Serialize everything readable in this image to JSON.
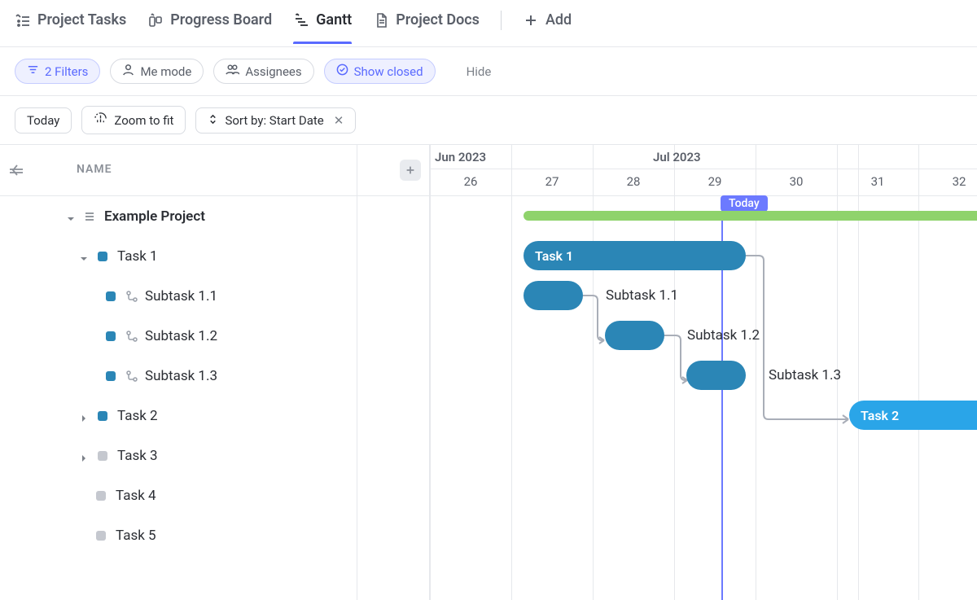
{
  "tabs": {
    "items": [
      {
        "label": "Project Tasks"
      },
      {
        "label": "Progress Board"
      },
      {
        "label": "Gantt"
      },
      {
        "label": "Project Docs"
      }
    ],
    "add": "Add"
  },
  "pills": {
    "filters": "2 Filters",
    "me_mode": "Me mode",
    "assignees": "Assignees",
    "show_closed": "Show closed",
    "hide": "Hide"
  },
  "toolbar": {
    "today": "Today",
    "zoom_fit": "Zoom to fit",
    "sort": "Sort by: Start Date",
    "sort_x": "✕"
  },
  "side": {
    "name_header": "NAME",
    "rows": {
      "project": "Example Project",
      "task1": "Task 1",
      "sub11": "Subtask 1.1",
      "sub12": "Subtask 1.2",
      "sub13": "Subtask 1.3",
      "task2": "Task 2",
      "task3": "Task 3",
      "task4": "Task 4",
      "task5": "Task 5"
    }
  },
  "timeline": {
    "months": {
      "jun": "Jun 2023",
      "jul": "Jul 2023"
    },
    "weeks": [
      "26",
      "27",
      "28",
      "29",
      "30",
      "31",
      "32"
    ],
    "today_label": "Today"
  },
  "bars": {
    "task1": "Task 1",
    "sub11": "Subtask 1.1",
    "sub12": "Subtask 1.2",
    "sub13": "Subtask 1.3",
    "task2": "Task 2"
  },
  "chart_data": {
    "type": "gantt",
    "time_axis": {
      "unit": "week",
      "start": 26,
      "end": 32,
      "today": 29.5,
      "months": [
        {
          "label": "Jun 2023",
          "from": 26,
          "to": 27
        },
        {
          "label": "Jul 2023",
          "from": 27,
          "to": 32
        }
      ]
    },
    "tasks": [
      {
        "name": "Example Project",
        "row": 0,
        "start": 27.1,
        "end": 33,
        "color": "green",
        "type": "summary"
      },
      {
        "name": "Task 1",
        "row": 1,
        "start": 27.1,
        "end": 29.7,
        "color": "blue",
        "expanded": true
      },
      {
        "name": "Subtask 1.1",
        "row": 2,
        "start": 27.15,
        "end": 27.85,
        "color": "blue",
        "parent": "Task 1"
      },
      {
        "name": "Subtask 1.2",
        "row": 3,
        "start": 28.2,
        "end": 28.85,
        "color": "blue",
        "parent": "Task 1"
      },
      {
        "name": "Subtask 1.3",
        "row": 4,
        "start": 29.15,
        "end": 29.85,
        "color": "blue",
        "parent": "Task 1"
      },
      {
        "name": "Task 2",
        "row": 5,
        "start": 31.15,
        "end": 33,
        "color": "bright-blue"
      },
      {
        "name": "Task 3",
        "row": 6
      },
      {
        "name": "Task 4",
        "row": 7
      },
      {
        "name": "Task 5",
        "row": 8
      }
    ],
    "dependencies": [
      {
        "from": "Subtask 1.1",
        "to": "Subtask 1.2"
      },
      {
        "from": "Subtask 1.2",
        "to": "Subtask 1.3"
      },
      {
        "from": "Task 1",
        "to": "Task 2"
      }
    ]
  }
}
